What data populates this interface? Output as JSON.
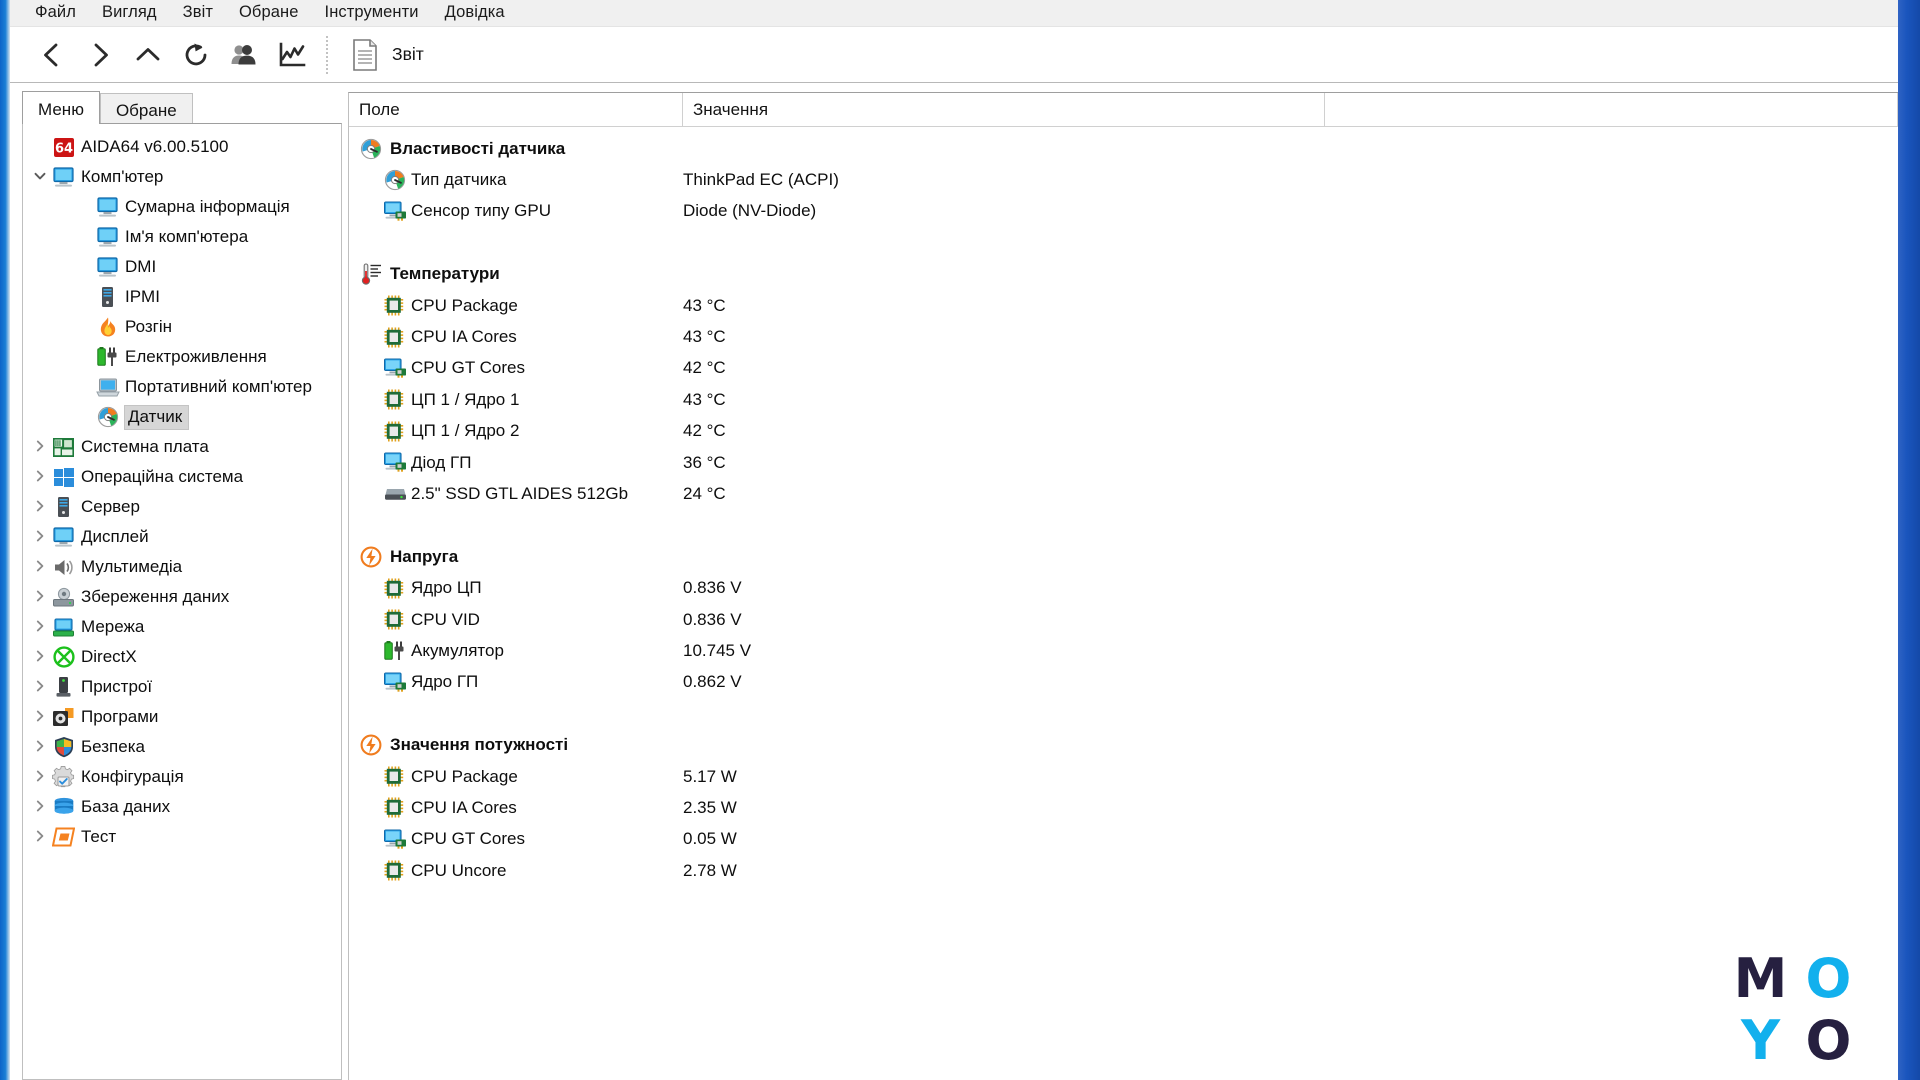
{
  "window": {
    "accent_blue": "#1b5fc4",
    "chrome_bg": "#f0f0f0"
  },
  "menubar": {
    "items": [
      {
        "label": "Файл",
        "name": "menu-file"
      },
      {
        "label": "Вигляд",
        "name": "menu-view"
      },
      {
        "label": "Звіт",
        "name": "menu-report"
      },
      {
        "label": "Обране",
        "name": "menu-favorites"
      },
      {
        "label": "Інструменти",
        "name": "menu-tools"
      },
      {
        "label": "Довідка",
        "name": "menu-help"
      }
    ]
  },
  "toolbar": {
    "buttons": [
      {
        "icon": "back-arrow-icon",
        "name": "toolbar-back-button"
      },
      {
        "icon": "forward-arrow-icon",
        "name": "toolbar-forward-button"
      },
      {
        "icon": "up-arrow-icon",
        "name": "toolbar-up-button"
      },
      {
        "icon": "refresh-icon",
        "name": "toolbar-refresh-button"
      },
      {
        "icon": "users-icon",
        "name": "toolbar-audit-button"
      },
      {
        "icon": "chart-icon",
        "name": "toolbar-chart-button"
      }
    ],
    "report_label": "Звіт",
    "report_icon": "document-icon"
  },
  "tabs": [
    {
      "label": "Меню",
      "active": true
    },
    {
      "label": "Обране",
      "active": false
    }
  ],
  "sidebar": {
    "items": [
      {
        "label": "AIDA64 v6.00.5100",
        "icon": "aida64-badge-icon",
        "level": 0,
        "twisty": "",
        "selected": false
      },
      {
        "label": "Комп'ютер",
        "icon": "monitor-icon",
        "level": 1,
        "twisty": "expanded",
        "selected": false
      },
      {
        "label": "Сумарна інформація",
        "icon": "monitor-icon",
        "level": 2,
        "twisty": "",
        "selected": false
      },
      {
        "label": "Ім'я комп'ютера",
        "icon": "monitor-icon",
        "level": 2,
        "twisty": "",
        "selected": false
      },
      {
        "label": "DMI",
        "icon": "monitor-icon",
        "level": 2,
        "twisty": "",
        "selected": false
      },
      {
        "label": "IPMI",
        "icon": "server-icon",
        "level": 2,
        "twisty": "",
        "selected": false
      },
      {
        "label": "Розгін",
        "icon": "flame-icon",
        "level": 2,
        "twisty": "",
        "selected": false
      },
      {
        "label": "Електроживлення",
        "icon": "battery-plug-icon",
        "level": 2,
        "twisty": "",
        "selected": false
      },
      {
        "label": "Портативний комп'ютер",
        "icon": "laptop-icon",
        "level": 2,
        "twisty": "",
        "selected": false
      },
      {
        "label": "Датчик",
        "icon": "sensor-gauge-icon",
        "level": 2,
        "twisty": "",
        "selected": true
      },
      {
        "label": "Системна плата",
        "icon": "motherboard-icon",
        "level": 1,
        "twisty": "collapsed",
        "selected": false
      },
      {
        "label": "Операційна система",
        "icon": "windows-icon",
        "level": 1,
        "twisty": "collapsed",
        "selected": false
      },
      {
        "label": "Сервер",
        "icon": "server-icon",
        "level": 1,
        "twisty": "collapsed",
        "selected": false
      },
      {
        "label": "Дисплей",
        "icon": "monitor-icon",
        "level": 1,
        "twisty": "collapsed",
        "selected": false
      },
      {
        "label": "Мультимедіа",
        "icon": "speaker-icon",
        "level": 1,
        "twisty": "collapsed",
        "selected": false
      },
      {
        "label": "Збереження даних",
        "icon": "storage-icon",
        "level": 1,
        "twisty": "collapsed",
        "selected": false
      },
      {
        "label": "Мережа",
        "icon": "network-icon",
        "level": 1,
        "twisty": "collapsed",
        "selected": false
      },
      {
        "label": "DirectX",
        "icon": "directx-icon",
        "level": 1,
        "twisty": "collapsed",
        "selected": false
      },
      {
        "label": "Пристрої",
        "icon": "device-icon",
        "level": 1,
        "twisty": "collapsed",
        "selected": false
      },
      {
        "label": "Програми",
        "icon": "programs-icon",
        "level": 1,
        "twisty": "collapsed",
        "selected": false
      },
      {
        "label": "Безпека",
        "icon": "shield-icon",
        "level": 1,
        "twisty": "collapsed",
        "selected": false
      },
      {
        "label": "Конфігурація",
        "icon": "gear-icon",
        "level": 1,
        "twisty": "collapsed",
        "selected": false
      },
      {
        "label": "База даних",
        "icon": "database-icon",
        "level": 1,
        "twisty": "collapsed",
        "selected": false
      },
      {
        "label": "Тест",
        "icon": "benchmark-icon",
        "level": 1,
        "twisty": "collapsed",
        "selected": false
      }
    ]
  },
  "main": {
    "columns": [
      {
        "label": "Поле",
        "name": "column-header-field"
      },
      {
        "label": "Значення",
        "name": "column-header-value"
      },
      {
        "label": "",
        "name": "column-header-blank"
      }
    ],
    "sections": [
      {
        "title": "Властивості датчика",
        "icon": "sensor-gauge-icon",
        "rows": [
          {
            "name": "Тип датчика",
            "icon": "sensor-gauge-icon",
            "value": "ThinkPad EC  (ACPI)"
          },
          {
            "name": "Сенсор типу GPU",
            "icon": "gpu-icon",
            "value": "Diode  (NV-Diode)"
          }
        ]
      },
      {
        "title": "Температури",
        "icon": "thermometer-icon",
        "rows": [
          {
            "name": "CPU Package",
            "icon": "cpu-icon",
            "value": "43 °C"
          },
          {
            "name": "CPU IA Cores",
            "icon": "cpu-icon",
            "value": "43 °C"
          },
          {
            "name": "CPU GT Cores",
            "icon": "gpu-icon",
            "value": "42 °C"
          },
          {
            "name": "ЦП 1 / Ядро 1",
            "icon": "cpu-icon",
            "value": "43 °C"
          },
          {
            "name": "ЦП 1 / Ядро 2",
            "icon": "cpu-icon",
            "value": "42 °C"
          },
          {
            "name": "Діод ГП",
            "icon": "gpu-icon",
            "value": "36 °C"
          },
          {
            "name": "2.5\" SSD GTL AIDES 512Gb",
            "icon": "disk-icon",
            "value": "24 °C"
          }
        ]
      },
      {
        "title": "Напруга",
        "icon": "power-bolt-icon",
        "rows": [
          {
            "name": "Ядро ЦП",
            "icon": "cpu-icon",
            "value": "0.836 V"
          },
          {
            "name": "CPU VID",
            "icon": "cpu-icon",
            "value": "0.836 V"
          },
          {
            "name": "Акумулятор",
            "icon": "battery-plug-icon",
            "value": "10.745 V"
          },
          {
            "name": "Ядро ГП",
            "icon": "gpu-icon",
            "value": "0.862 V"
          }
        ]
      },
      {
        "title": "Значення потужності",
        "icon": "power-bolt-icon",
        "rows": [
          {
            "name": "CPU Package",
            "icon": "cpu-icon",
            "value": "5.17 W"
          },
          {
            "name": "CPU IA Cores",
            "icon": "cpu-icon",
            "value": "2.35 W"
          },
          {
            "name": "CPU GT Cores",
            "icon": "gpu-icon",
            "value": "0.05 W"
          },
          {
            "name": "CPU Uncore",
            "icon": "cpu-icon",
            "value": "2.78 W"
          }
        ]
      }
    ]
  },
  "watermark": {
    "letters": [
      {
        "ch": "M",
        "color": "#262040"
      },
      {
        "ch": "O",
        "color": "#12b0ed"
      },
      {
        "ch": "Y",
        "color": "#12b0ed"
      },
      {
        "ch": "O",
        "color": "#262040"
      }
    ]
  }
}
